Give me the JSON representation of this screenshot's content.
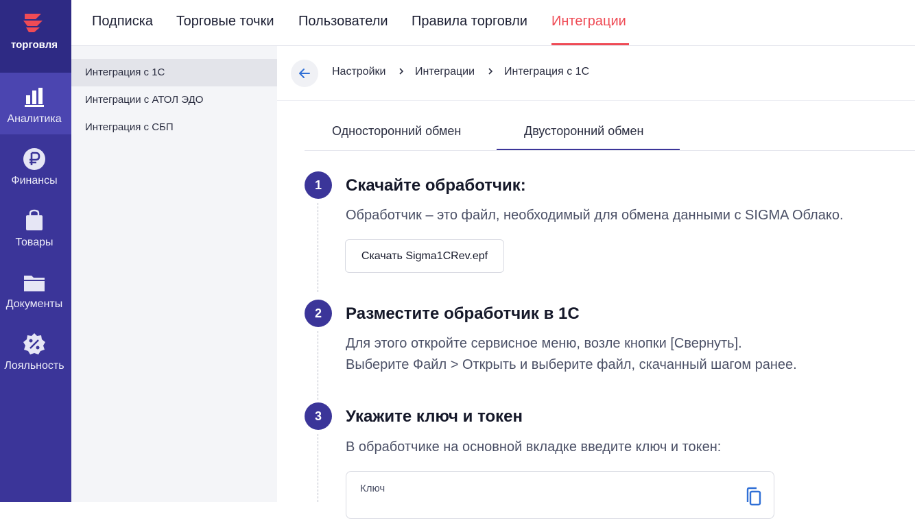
{
  "brand": {
    "name": "торговля"
  },
  "rail": {
    "items": [
      {
        "label": "Аналитика",
        "icon": "analytics-icon",
        "active": true
      },
      {
        "label": "Финансы",
        "icon": "ruble-icon",
        "active": false
      },
      {
        "label": "Товары",
        "icon": "shopping-bag-icon",
        "active": false
      },
      {
        "label": "Документы",
        "icon": "folder-icon",
        "active": false
      },
      {
        "label": "Лояльность",
        "icon": "percent-badge-icon",
        "active": false
      }
    ]
  },
  "topnav": {
    "tabs": [
      {
        "label": "Подписка"
      },
      {
        "label": "Торговые точки"
      },
      {
        "label": "Пользователи"
      },
      {
        "label": "Правила торговли"
      },
      {
        "label": "Интеграции",
        "active": true
      }
    ]
  },
  "subside": {
    "items": [
      {
        "label": "Интеграция с 1С",
        "active": true
      },
      {
        "label": "Интеграции с АТОЛ ЭДО"
      },
      {
        "label": "Интеграция с СБП"
      }
    ]
  },
  "breadcrumb": [
    "Настройки",
    "Интеграции",
    "Интеграция с 1С"
  ],
  "exchange_tabs": [
    {
      "label": "Односторонний обмен"
    },
    {
      "label": "Двусторонний обмен",
      "active": true
    }
  ],
  "steps": [
    {
      "number": "1",
      "title": "Скачайте обработчик:",
      "desc": [
        "Обработчик – это файл, необходимый для обмена данными с SIGMA Облако."
      ]
    },
    {
      "number": "2",
      "title": "Разместите обработчик в 1С",
      "desc": [
        "Для этого откройте сервисное меню, возле кнопки [Свернуть].",
        "Выберите Файл > Открыть и выберите файл, скачанный шагом ранее."
      ]
    },
    {
      "number": "3",
      "title": "Укажите ключ и токен",
      "desc": [
        "В обработчике на основной вкладке введите ключ и токен:"
      ]
    }
  ],
  "download_button": "Скачать Sigma1CRev.epf",
  "key_field": {
    "label": "Ключ"
  },
  "colors": {
    "rail": "#3b3599",
    "accent": "#ef4b55",
    "step": "#3b3599"
  }
}
